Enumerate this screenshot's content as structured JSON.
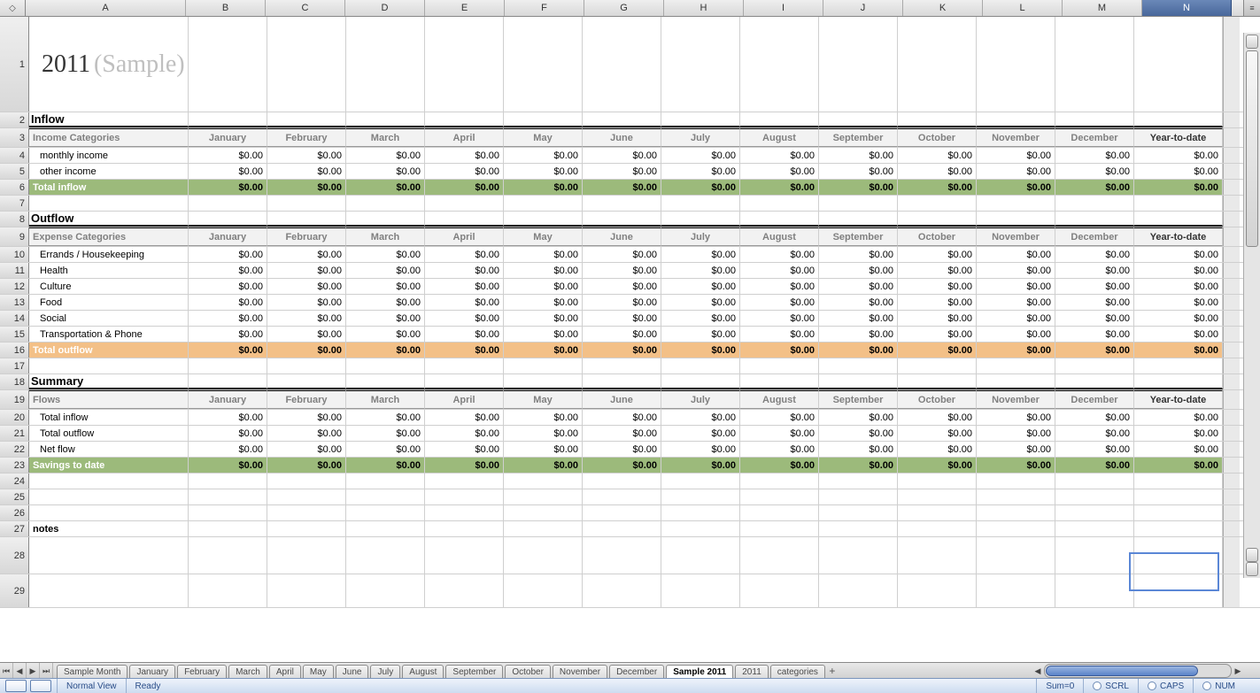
{
  "columns": [
    "A",
    "B",
    "C",
    "D",
    "E",
    "F",
    "G",
    "H",
    "I",
    "J",
    "K",
    "L",
    "M",
    "N"
  ],
  "selected_column": "N",
  "title": {
    "year": "2011",
    "suffix": "(Sample)"
  },
  "months": [
    "January",
    "February",
    "March",
    "April",
    "May",
    "June",
    "July",
    "August",
    "September",
    "October",
    "November",
    "December"
  ],
  "ytd_label": "Year-to-date",
  "zero": "$0.00",
  "inflow": {
    "heading": "Inflow",
    "cat_label": "Income Categories",
    "rows": [
      "monthly income",
      "other income"
    ],
    "total_label": "Total inflow"
  },
  "outflow": {
    "heading": "Outflow",
    "cat_label": "Expense Categories",
    "rows": [
      "Errands / Housekeeping",
      "Health",
      "Culture",
      "Food",
      "Social",
      "Transportation & Phone"
    ],
    "total_label": "Total outflow"
  },
  "summary": {
    "heading": "Summary",
    "cat_label": "Flows",
    "rows": [
      "Total inflow",
      "Total outflow",
      "Net flow"
    ],
    "total_label": "Savings to date"
  },
  "notes_label": "notes",
  "tabs": [
    "Sample Month",
    "January",
    "February",
    "March",
    "April",
    "May",
    "June",
    "July",
    "August",
    "September",
    "October",
    "November",
    "December",
    "Sample 2011",
    "2011",
    "categories"
  ],
  "active_tab": "Sample 2011",
  "status": {
    "view": "Normal View",
    "ready": "Ready",
    "sum": "Sum=0",
    "scrl": "SCRL",
    "caps": "CAPS",
    "num": "NUM"
  }
}
